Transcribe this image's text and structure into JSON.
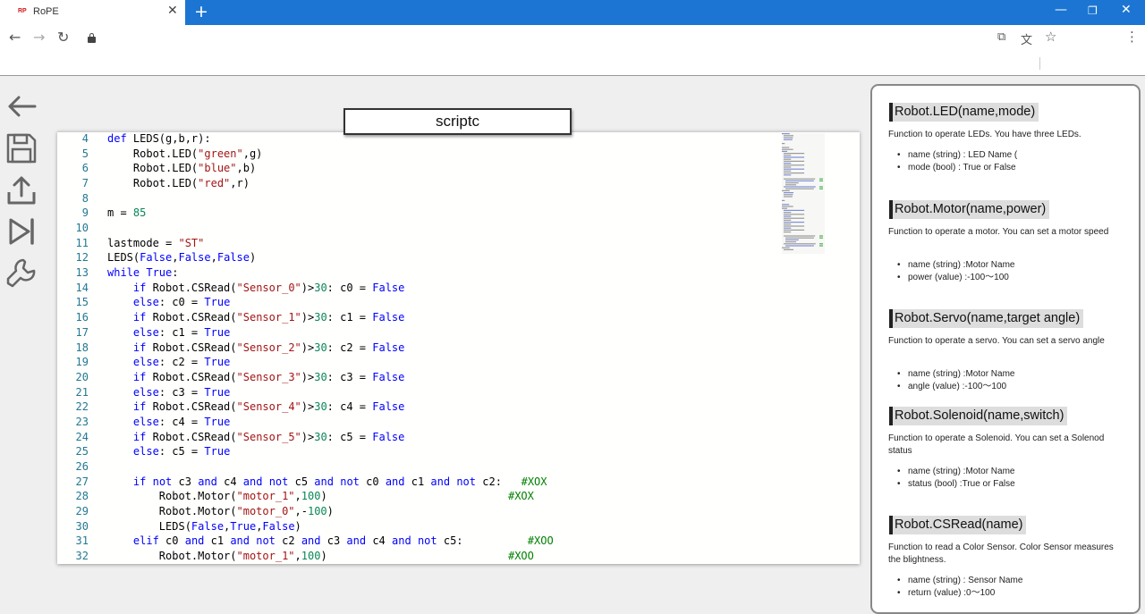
{
  "browser": {
    "tab_title": "RoPE",
    "favicon_text": "RP"
  },
  "editor": {
    "title": "scriptc",
    "lines": [
      {
        "n": "4",
        "text": "def LEDS(g,b,r):"
      },
      {
        "n": "5",
        "text": "    Robot.LED(\"green\",g)"
      },
      {
        "n": "6",
        "text": "    Robot.LED(\"blue\",b)"
      },
      {
        "n": "7",
        "text": "    Robot.LED(\"red\",r)"
      },
      {
        "n": "8",
        "text": ""
      },
      {
        "n": "9",
        "text": "m = 85"
      },
      {
        "n": "10",
        "text": ""
      },
      {
        "n": "11",
        "text": "lastmode = \"ST\""
      },
      {
        "n": "12",
        "text": "LEDS(False,False,False)"
      },
      {
        "n": "13",
        "text": "while True:"
      },
      {
        "n": "14",
        "text": "    if Robot.CSRead(\"Sensor_0\")>30: c0 = False"
      },
      {
        "n": "15",
        "text": "    else: c0 = True"
      },
      {
        "n": "16",
        "text": "    if Robot.CSRead(\"Sensor_1\")>30: c1 = False"
      },
      {
        "n": "17",
        "text": "    else: c1 = True"
      },
      {
        "n": "18",
        "text": "    if Robot.CSRead(\"Sensor_2\")>30: c2 = False"
      },
      {
        "n": "19",
        "text": "    else: c2 = True"
      },
      {
        "n": "20",
        "text": "    if Robot.CSRead(\"Sensor_3\")>30: c3 = False"
      },
      {
        "n": "21",
        "text": "    else: c3 = True"
      },
      {
        "n": "22",
        "text": "    if Robot.CSRead(\"Sensor_4\")>30: c4 = False"
      },
      {
        "n": "23",
        "text": "    else: c4 = True"
      },
      {
        "n": "24",
        "text": "    if Robot.CSRead(\"Sensor_5\")>30: c5 = False"
      },
      {
        "n": "25",
        "text": "    else: c5 = True"
      },
      {
        "n": "26",
        "text": ""
      },
      {
        "n": "27",
        "text": "    if not c3 and c4 and not c5 and not c0 and c1 and not c2:   #XOX"
      },
      {
        "n": "28",
        "text": "        Robot.Motor(\"motor_1\",100)                            #XOX"
      },
      {
        "n": "29",
        "text": "        Robot.Motor(\"motor_0\",-100)"
      },
      {
        "n": "30",
        "text": "        LEDS(False,True,False)"
      },
      {
        "n": "31",
        "text": "    elif c0 and c1 and not c2 and c3 and c4 and not c5:          #XOO"
      },
      {
        "n": "32",
        "text": "        Robot.Motor(\"motor_1\",100)                            #XOO"
      }
    ]
  },
  "docs": [
    {
      "heading": "Robot.LED(name,mode)",
      "desc": "Function to operate LEDs. You have three LEDs.",
      "items": [
        "name (string) : LED Name (",
        "mode (bool) : True or False"
      ]
    },
    {
      "heading": "Robot.Motor(name,power)",
      "desc": "Function to operate a motor. You can set a motor speed",
      "items": [
        "name (string) :Motor Name",
        "power (value) :-100〜100"
      ]
    },
    {
      "heading": "Robot.Servo(name,target angle)",
      "desc": "Function to operate a servo. You can set a servo angle",
      "items": [
        "name (string) :Motor Name",
        "angle (value) :-100〜100"
      ]
    },
    {
      "heading": "Robot.Solenoid(name,switch)",
      "desc": "Function to operate a Solenoid. You can set a Solenod status",
      "items": [
        "name (string) :Motor Name",
        "status (bool) :True or False"
      ]
    },
    {
      "heading": "Robot.CSRead(name)",
      "desc": "Function to read a Color Sensor. Color Sensor measures the blightness.",
      "items": [
        "name (string) : Sensor Name",
        "return (value) :0〜100"
      ]
    }
  ],
  "colors": {
    "keyword": "#0000ff",
    "string": "#a31515",
    "number": "#098658",
    "comment": "#008000",
    "linenumber": "#237893",
    "tabbar": "#1c75d2"
  }
}
